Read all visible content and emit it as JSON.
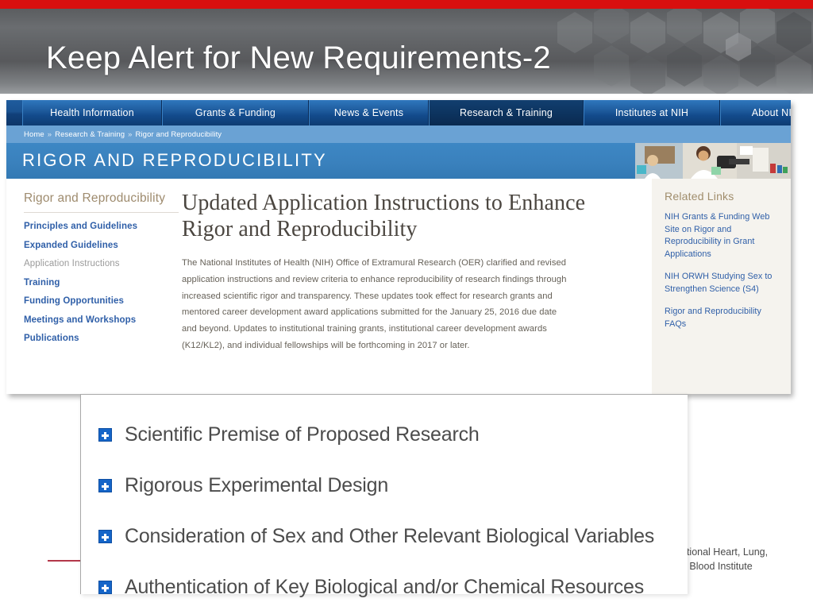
{
  "slide": {
    "title": "Keep Alert for New Requirements-2",
    "accent_red": "#d90f0f",
    "banner_gray": "#6a6d70"
  },
  "site": {
    "nav": [
      {
        "label": "Health Information",
        "active": false
      },
      {
        "label": "Grants & Funding",
        "active": false
      },
      {
        "label": "News & Events",
        "active": false
      },
      {
        "label": "Research & Training",
        "active": true
      },
      {
        "label": "Institutes at NIH",
        "active": false
      },
      {
        "label": "About NIH",
        "active": false
      }
    ],
    "breadcrumb": {
      "items": [
        "Home",
        "Research & Training",
        "Rigor and Reproducibility"
      ],
      "separator": "»"
    },
    "hero": {
      "title": "RIGOR AND REPRODUCIBILITY",
      "photo_alt": "lab-researchers-photo"
    },
    "left_sidebar": {
      "heading": "Rigor and Reproducibility",
      "items": [
        {
          "label": "Principles and Guidelines",
          "current": false
        },
        {
          "label": "Expanded Guidelines",
          "current": false
        },
        {
          "label": "Application Instructions",
          "current": true
        },
        {
          "label": "Training",
          "current": false
        },
        {
          "label": "Funding Opportunities",
          "current": false
        },
        {
          "label": "Meetings and Workshops",
          "current": false
        },
        {
          "label": "Publications",
          "current": false
        }
      ]
    },
    "main": {
      "heading": "Updated Application Instructions to Enhance Rigor and Reproducibility",
      "paragraph": "The National Institutes of Health (NIH) Office of Extramural Research (OER) clarified and revised application instructions and review criteria to enhance reproducibility of research findings through increased scientific rigor and transparency. These updates took effect for research grants and mentored career development award applications submitted for the January 25, 2016 due date and beyond. Updates to institutional training grants, institutional career development awards (K12/KL2), and individual fellowships will be forthcoming in 2017 or later."
    },
    "right_sidebar": {
      "heading": "Related Links",
      "links": [
        "NIH Grants & Funding Web Site on Rigor and Reproducibility in Grant Applications",
        "NIH ORWH Studying Sex to Strengthen Science (S4)",
        "Rigor and Reproducibility FAQs"
      ]
    }
  },
  "overlay": {
    "items": [
      {
        "icon": "plus-square-icon",
        "label": "Scientific Premise of Proposed Research"
      },
      {
        "icon": "plus-square-icon",
        "label": "Rigorous Experimental Design"
      },
      {
        "icon": "plus-square-icon",
        "label": "Consideration of Sex and Other Relevant Biological Variables"
      },
      {
        "icon": "plus-square-icon",
        "label": "Authentication of Key Biological and/or Chemical Resources"
      }
    ],
    "plus_icon_color": "#1565c8"
  },
  "footer_caption": {
    "line1": "ational Heart, Lung,",
    "line2": "d Blood Institute"
  }
}
